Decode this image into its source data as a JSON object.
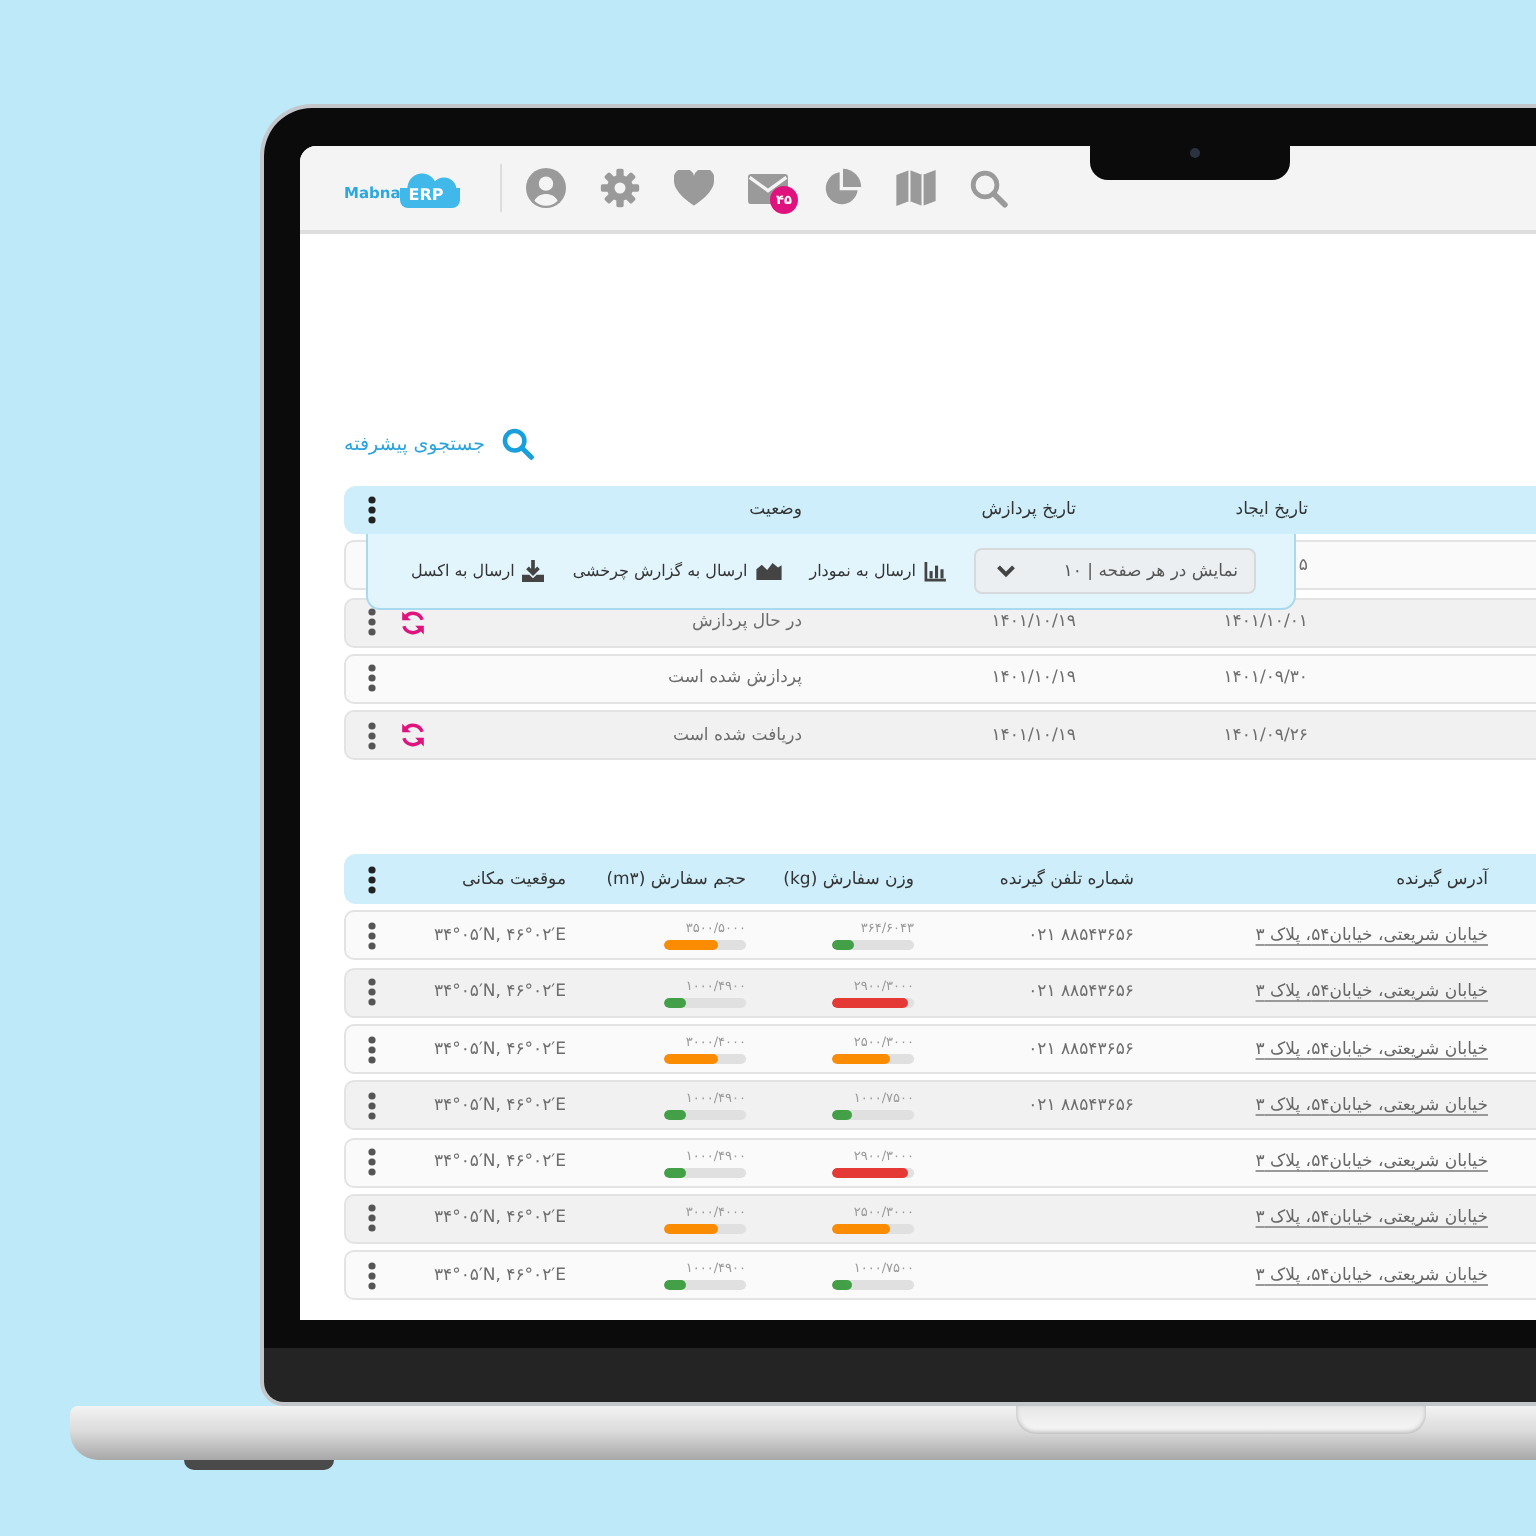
{
  "logo": {
    "text": "Mabna",
    "badge": "ERP"
  },
  "toolbar": {
    "mail_badge": "۴۵"
  },
  "advanced_search": {
    "label": "جستجوی پیشرفته"
  },
  "status_table": {
    "columns": [
      "تاریخ ایجاد",
      "تاریخ پردازش",
      "وضعیت"
    ],
    "rows": [
      {
        "created": "۵"
      },
      {
        "created": "۱۴۰۱/۱۰/۰۱",
        "processed": "۱۴۰۱/۱۰/۱۹",
        "status": "در حال پردازش",
        "refresh": true
      },
      {
        "created": "۱۴۰۱/۰۹/۳۰",
        "processed": "۱۴۰۱/۱۰/۱۹",
        "status": "پردازش شده است",
        "refresh": false
      },
      {
        "created": "۱۴۰۱/۰۹/۲۶",
        "processed": "۱۴۰۱/۱۰/۱۹",
        "status": "دریافت شده است",
        "refresh": true
      }
    ]
  },
  "export_menu": {
    "page_size": "نمایش در هر صفحه | ۱۰",
    "actions": [
      {
        "kind": "chart",
        "label": "ارسال به نمودار"
      },
      {
        "kind": "pivot",
        "label": "ارسال به گزارش چرخشی"
      },
      {
        "kind": "excel",
        "label": "ارسال به اکسل"
      }
    ]
  },
  "orders_table": {
    "columns": [
      "آدرس گیرنده",
      "شماره تلفن گیرنده",
      "وزن سفارش (kg)",
      "حجم سفارش (m۳)",
      "موقعیت مکانی"
    ],
    "rows": [
      {
        "address": "خیابان شریعتی، خیابان۵۴، پلاک ۳",
        "phone": "۰۲۱ ۸۸۵۴۳۶۵۶",
        "weight": {
          "value": "۳۶۴/۶۰۴۳",
          "level": 0.26
        },
        "volume": {
          "value": "۳۵۰۰/۵۰۰۰",
          "level": 0.65
        },
        "location": "۳۴°۰۵′N, ۴۶°۰۲′E"
      },
      {
        "address": "خیابان شریعتی، خیابان۵۴، پلاک ۳",
        "phone": "۰۲۱ ۸۸۵۴۳۶۵۶",
        "weight": {
          "value": "۲۹۰۰/۳۰۰۰",
          "level": 0.93
        },
        "volume": {
          "value": "۱۰۰۰/۴۹۰۰",
          "level": 0.28
        },
        "location": "۳۴°۰۵′N, ۴۶°۰۲′E"
      },
      {
        "address": "خیابان شریعتی، خیابان۵۴، پلاک ۳",
        "phone": "۰۲۱ ۸۸۵۴۳۶۵۶",
        "weight": {
          "value": "۲۵۰۰/۳۰۰۰",
          "level": 0.7
        },
        "volume": {
          "value": "۳۰۰۰/۴۰۰۰",
          "level": 0.67
        },
        "location": "۳۴°۰۵′N, ۴۶°۰۲′E"
      },
      {
        "address": "خیابان شریعتی، خیابان۵۴، پلاک ۳",
        "phone": "۰۲۱ ۸۸۵۴۳۶۵۶",
        "weight": {
          "value": "۱۰۰۰/۷۵۰۰",
          "level": 0.25
        },
        "volume": {
          "value": "۱۰۰۰/۴۹۰۰",
          "level": 0.28
        },
        "location": "۳۴°۰۵′N, ۴۶°۰۲′E"
      },
      {
        "address": "خیابان شریعتی، خیابان۵۴، پلاک ۳",
        "weight": {
          "value": "۲۹۰۰/۳۰۰۰",
          "level": 0.93
        },
        "volume": {
          "value": "۱۰۰۰/۴۹۰۰",
          "level": 0.28
        },
        "location": "۳۴°۰۵′N, ۴۶°۰۲′E"
      },
      {
        "address": "خیابان شریعتی، خیابان۵۴، پلاک ۳",
        "weight": {
          "value": "۲۵۰۰/۳۰۰۰",
          "level": 0.7
        },
        "volume": {
          "value": "۳۰۰۰/۴۰۰۰",
          "level": 0.67
        },
        "location": "۳۴°۰۵′N, ۴۶°۰۲′E"
      },
      {
        "address": "خیابان شریعتی، خیابان۵۴، پلاک ۳",
        "weight": {
          "value": "۱۰۰۰/۷۵۰۰",
          "level": 0.25
        },
        "volume": {
          "value": "۱۰۰۰/۴۹۰۰",
          "level": 0.28
        },
        "location": "۳۴°۰۵′N, ۴۶°۰۲′E"
      }
    ]
  }
}
